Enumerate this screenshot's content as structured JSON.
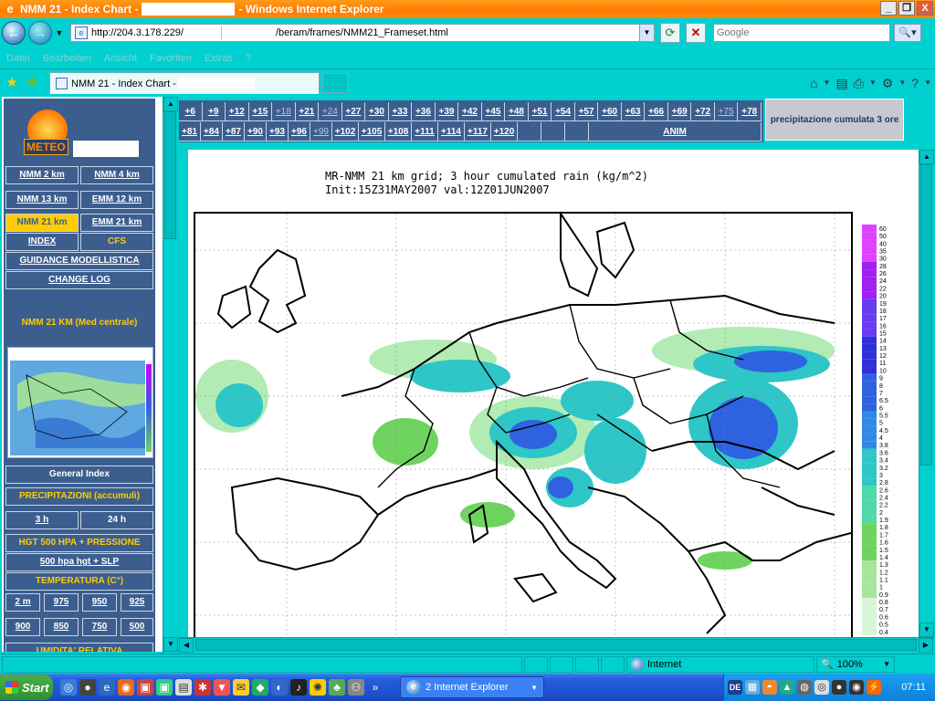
{
  "window": {
    "title_prefix": "NMM 21 - Index Chart -",
    "title_suffix": "- Windows Internet Explorer",
    "min_glyph": "_",
    "max_glyph": "❐",
    "close_glyph": "X"
  },
  "address": {
    "url": "http://204.3.178.229/",
    "url_tail": "/beram/frames/NMM21_Frameset.html"
  },
  "search": {
    "placeholder": "Google"
  },
  "menu": [
    "Datei",
    "Bearbeiten",
    "Ansicht",
    "Favoriten",
    "Extras",
    "?"
  ],
  "tab": {
    "title": "NMM 21 - Index Chart -"
  },
  "left_panel": {
    "logo_text": "METEO",
    "buttons": [
      {
        "label": "NMM 2 km"
      },
      {
        "label": "NMM 4 km"
      },
      {
        "label": "NMM 13 km"
      },
      {
        "label": "EMM 12 km"
      },
      {
        "label": "NMM 21 km"
      },
      {
        "label": "EMM 21 km"
      },
      {
        "label": "INDEX"
      },
      {
        "label": "CFS"
      },
      {
        "label": "GUIDANCE MODELLISTICA"
      },
      {
        "label": "CHANGE LOG"
      }
    ],
    "section_title": "NMM 21 KM (Med centrale)",
    "general_index": "General Index",
    "precipitazioni": "PRECIPITAZIONI (accumuli)",
    "precip_options": [
      "3 h",
      "24 h"
    ],
    "hgt500": "HGT 500 HPA + PRESSIONE",
    "hgt500_slp": "500 hpa hgt + SLP",
    "temperatura": "TEMPERATURA (C°)",
    "temp_levels_row1": [
      "2 m",
      "975",
      "950",
      "925"
    ],
    "temp_levels_row2": [
      "900",
      "850",
      "750",
      "500"
    ],
    "umidita": "UMIDITA' RELATIVA"
  },
  "forecast_nav": {
    "row1": [
      "+6",
      "+9",
      "+12",
      "+15",
      "+18",
      "+21",
      "+24",
      "+27",
      "+30",
      "+33",
      "+36",
      "+39",
      "+42",
      "+45",
      "+48",
      "+51",
      "+54",
      "+57",
      "+60",
      "+63",
      "+66",
      "+69",
      "+72",
      "+75",
      "+78"
    ],
    "row1_dim": [
      "+18",
      "+24",
      "+75"
    ],
    "row2": [
      "+81",
      "+84",
      "+87",
      "+90",
      "+93",
      "+96",
      "+99",
      "+102",
      "+105",
      "+108",
      "+111",
      "+114",
      "+117",
      "+120"
    ],
    "row2_dim": [
      "+99"
    ],
    "anim": "ANIM",
    "precip_label": "precipitazione cumulata 3 ore"
  },
  "chart_data": {
    "type": "heatmap",
    "title_line1": "MR-NMM 21 km grid; 3 hour cumulated rain (kg/m^2)",
    "title_line2": "Init:15Z31MAY2007 val:12Z01JUN2007",
    "colorbar_ticks": [
      "60",
      "50",
      "40",
      "35",
      "30",
      "28",
      "26",
      "24",
      "22",
      "20",
      "19",
      "18",
      "17",
      "16",
      "15",
      "14",
      "13",
      "12",
      "11",
      "10",
      "9",
      "8",
      "7",
      "6.5",
      "6",
      "5.5",
      "5",
      "4.5",
      "4",
      "3.8",
      "3.6",
      "3.4",
      "3.2",
      "3",
      "2.8",
      "2.6",
      "2.4",
      "2.2",
      "2",
      "1.9",
      "1.8",
      "1.7",
      "1.6",
      "1.5",
      "1.4",
      "1.3",
      "1.2",
      "1.1",
      "1",
      "0.9",
      "0.8",
      "0.7",
      "0.6",
      "0.5",
      "0.4"
    ],
    "colors": {
      "light": "#d8f5d8",
      "green": "#6fd35f",
      "teal": "#2ec6c6",
      "blue": "#2f62e0",
      "violet": "#a020f0",
      "magenta": "#e040ff"
    }
  },
  "status": {
    "zone": "Internet",
    "zoom": "100%"
  },
  "taskbar": {
    "start": "Start",
    "task_button": "2 Internet Explorer",
    "lang": "DE",
    "clock": "07:11"
  }
}
